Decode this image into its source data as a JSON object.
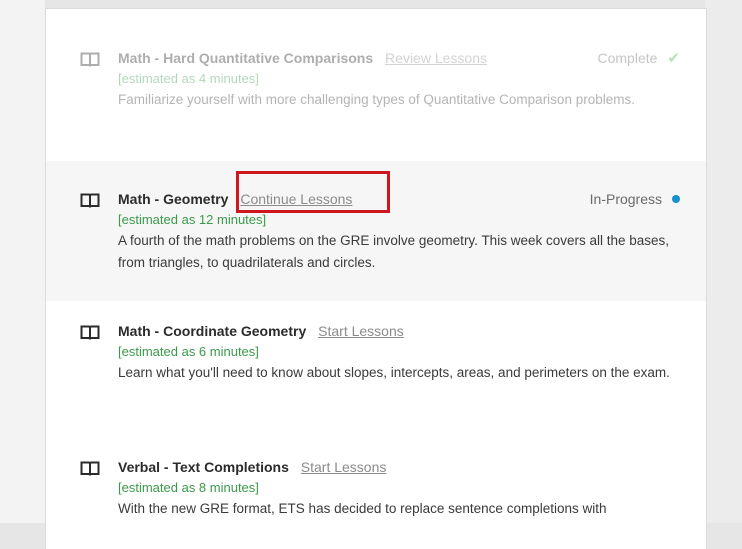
{
  "lessons": [
    {
      "title": "Math - Hard Quantitative Comparisons",
      "action": "Review Lessons",
      "estimate": "[estimated as 4 minutes]",
      "description": "Familiarize yourself with more challenging types of Quantitative Comparison problems.",
      "status": "Complete",
      "status_icon": "checkmark-icon"
    },
    {
      "title": "Math - Geometry",
      "action": "Continue Lessons",
      "estimate": "[estimated as 12 minutes]",
      "description": "A fourth of the math problems on the GRE involve geometry. This week covers all the bases, from triangles, to quadrilaterals and circles.",
      "status": "In-Progress",
      "status_icon": "dot-icon"
    },
    {
      "title": "Math - Coordinate Geometry",
      "action": "Start Lessons",
      "estimate": "[estimated as 6 minutes]",
      "description": "Learn what you'll need to know about slopes, intercepts, areas, and perimeters on the exam.",
      "status": "",
      "status_icon": ""
    },
    {
      "title": "Verbal - Text Completions",
      "action": "Start Lessons",
      "estimate": "[estimated as 8 minutes]",
      "description": "With the new GRE format, ETS has decided to replace sentence completions with",
      "status": "",
      "status_icon": ""
    }
  ],
  "colors": {
    "estimate_green": "#3b9a4a",
    "in_progress_dot": "#1a8ed1",
    "complete_check": "#4caf50",
    "highlight_red": "#d0161e"
  }
}
